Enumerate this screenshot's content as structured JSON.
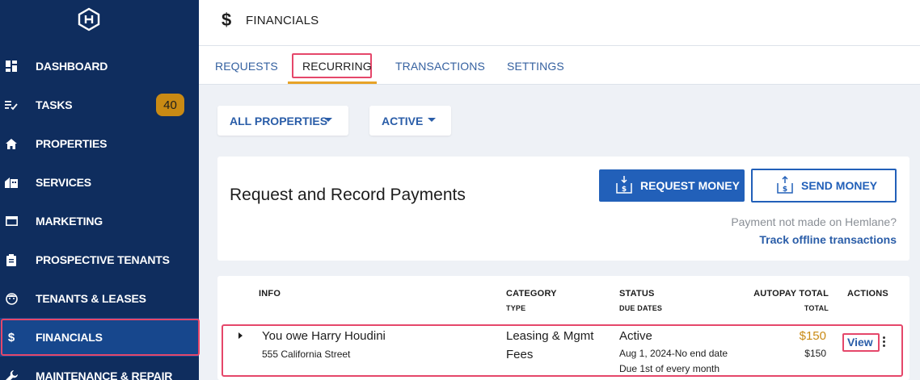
{
  "sidebar": {
    "items": [
      {
        "label": "DASHBOARD",
        "icon": "dashboard-icon"
      },
      {
        "label": "TASKS",
        "icon": "tasks-icon",
        "badge": "40"
      },
      {
        "label": "PROPERTIES",
        "icon": "home-icon"
      },
      {
        "label": "SERVICES",
        "icon": "services-icon"
      },
      {
        "label": "MARKETING",
        "icon": "marketing-icon"
      },
      {
        "label": "PROSPECTIVE TENANTS",
        "icon": "clipboard-icon"
      },
      {
        "label": "TENANTS & LEASES",
        "icon": "tenants-icon"
      },
      {
        "label": "FINANCIALS",
        "icon": "dollar-icon"
      },
      {
        "label": "MAINTENANCE & REPAIR",
        "icon": "wrench-icon"
      }
    ]
  },
  "header": {
    "icon": "$",
    "title": "FINANCIALS"
  },
  "tabs": [
    "REQUESTS",
    "RECURRING",
    "TRANSACTIONS",
    "SETTINGS"
  ],
  "active_tab": "RECURRING",
  "filters": {
    "property": "ALL PROPERTIES",
    "status": "ACTIVE"
  },
  "card": {
    "title": "Request and Record Payments",
    "request_money": "REQUEST MONEY",
    "send_money": "SEND MONEY",
    "note": "Payment not made on Hemlane?",
    "link": "Track offline transactions"
  },
  "table": {
    "headers": {
      "info": "INFO",
      "category": "CATEGORY",
      "category_sub": "TYPE",
      "status": "STATUS",
      "status_sub": "DUE DATES",
      "autopay": "AUTOPAY TOTAL",
      "autopay_sub": "TOTAL",
      "actions": "ACTIONS"
    },
    "rows": [
      {
        "info_title": "You owe Harry Houdini",
        "info_address": "555 California Street",
        "category_line1": "Leasing & Mgmt",
        "category_line2": "Fees",
        "status": "Active",
        "due_dates": "Aug 1, 2024-No end date",
        "due_rule": "Due 1st of every month",
        "autopay_total": "$150",
        "total": "$150",
        "action": "View"
      }
    ]
  },
  "colors": {
    "sidebar_bg": "#0f2d5e",
    "primary": "#2260b9",
    "badge": "#c98a14",
    "highlight": "#e5476a",
    "amount": "#c98a14"
  }
}
